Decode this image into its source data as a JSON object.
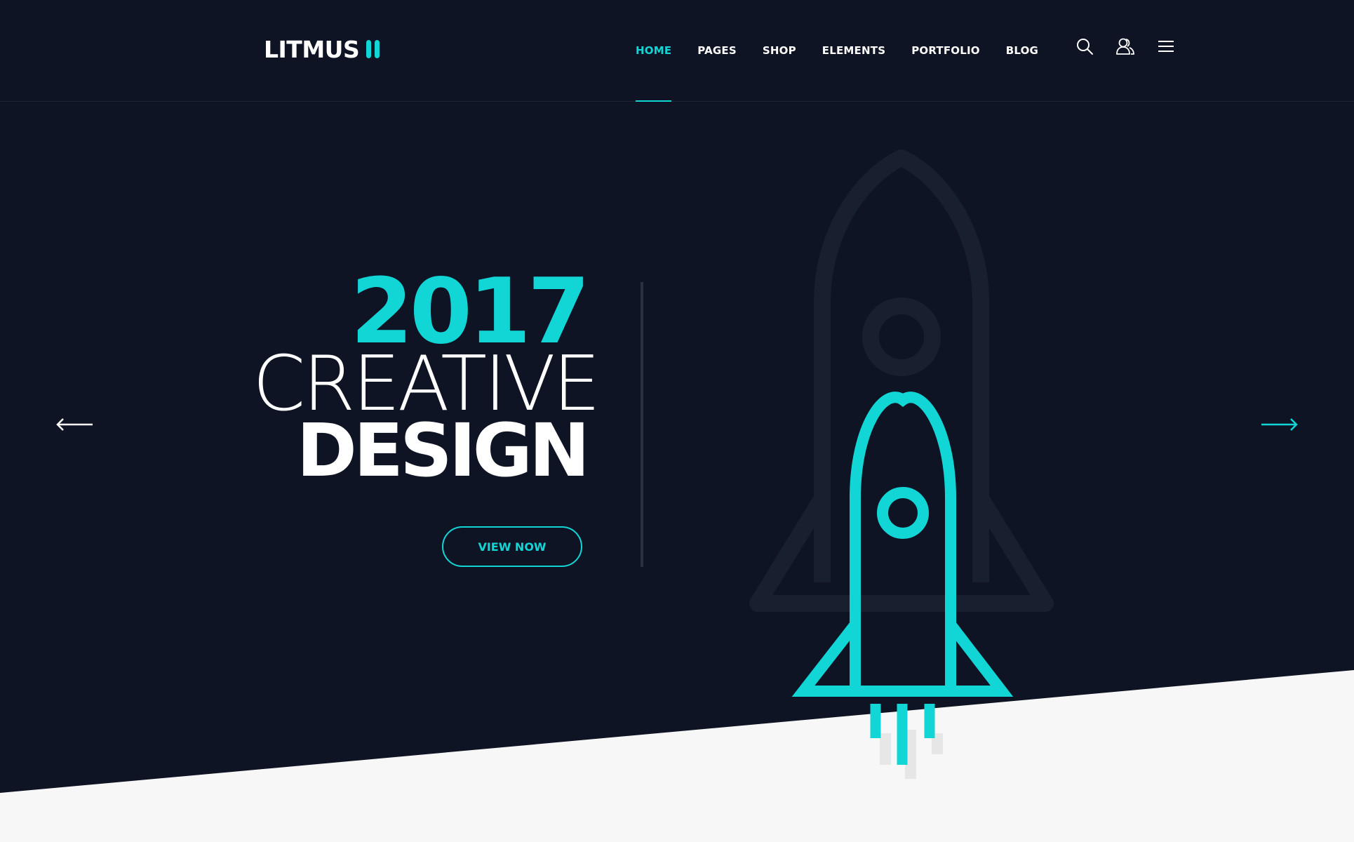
{
  "brand": {
    "name": "LITMUS"
  },
  "nav": {
    "items": [
      {
        "label": "HOME",
        "active": true
      },
      {
        "label": "PAGES",
        "active": false
      },
      {
        "label": "SHOP",
        "active": false
      },
      {
        "label": "ELEMENTS",
        "active": false
      },
      {
        "label": "PORTFOLIO",
        "active": false
      },
      {
        "label": "BLOG",
        "active": false
      }
    ]
  },
  "header_icons": [
    "search-icon",
    "user-icon",
    "menu-icon"
  ],
  "hero": {
    "year": "2017",
    "line2": "CREATIVE",
    "line3": "DESIGN",
    "cta_label": "VIEW NOW"
  },
  "colors": {
    "background": "#0e1423",
    "accent": "#12d6d6",
    "text": "#ffffff",
    "lower_section": "#f7f7f7"
  }
}
